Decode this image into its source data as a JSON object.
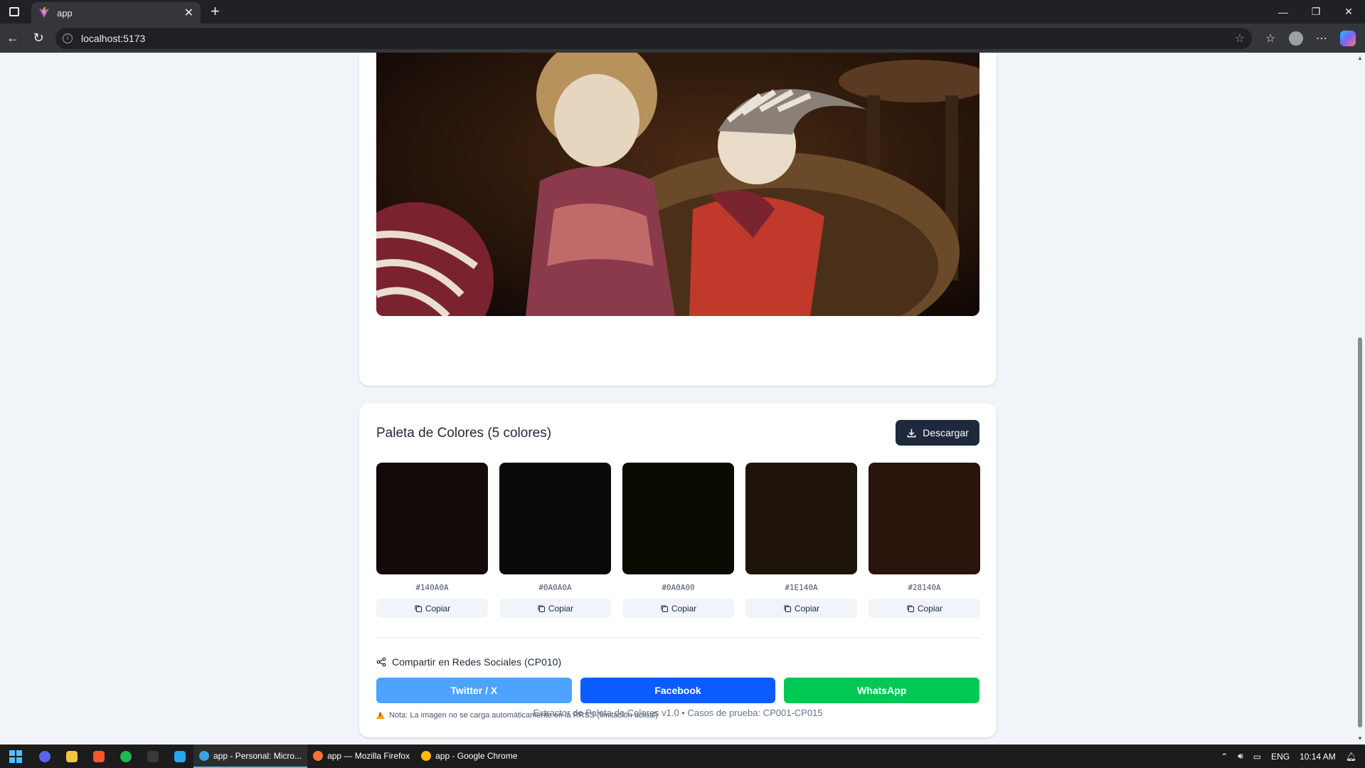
{
  "browser": {
    "tab_title": "app",
    "url": "localhost:5173"
  },
  "palette": {
    "title": "Paleta de Colores (5 colores)",
    "download_label": "Descargar",
    "copy_label": "Copiar",
    "colors": [
      {
        "hex": "#140A0A",
        "value": "#140A0A"
      },
      {
        "hex": "#0A0A0A",
        "value": "#0A0A0A"
      },
      {
        "hex": "#0A0A00",
        "value": "#0A0A00"
      },
      {
        "hex": "#1E140A",
        "value": "#1E140A"
      },
      {
        "hex": "#28140A",
        "value": "#28140A"
      }
    ]
  },
  "share": {
    "heading": "Compartir en Redes Sociales (CP010)",
    "buttons": [
      {
        "label": "Twitter / X",
        "color": "#4da3ff"
      },
      {
        "label": "Facebook",
        "color": "#0b5cff"
      },
      {
        "label": "WhatsApp",
        "color": "#00c853"
      }
    ],
    "note": "Nota: La imagen no se carga automáticamente en la RRSS (limitación actual)"
  },
  "footer": "Extractor de Paleta de Colores v1.0 • Casos de prueba: CP001-CP015",
  "taskbar": {
    "windows": [
      {
        "label": "app - Personal: Micro...",
        "color": "#3aa3e3"
      },
      {
        "label": "app — Mozilla Firefox",
        "color": "#ff7139"
      },
      {
        "label": "app - Google Chrome",
        "color": "#fbbc04"
      }
    ],
    "language": "ENG",
    "time": "10:14 AM"
  }
}
